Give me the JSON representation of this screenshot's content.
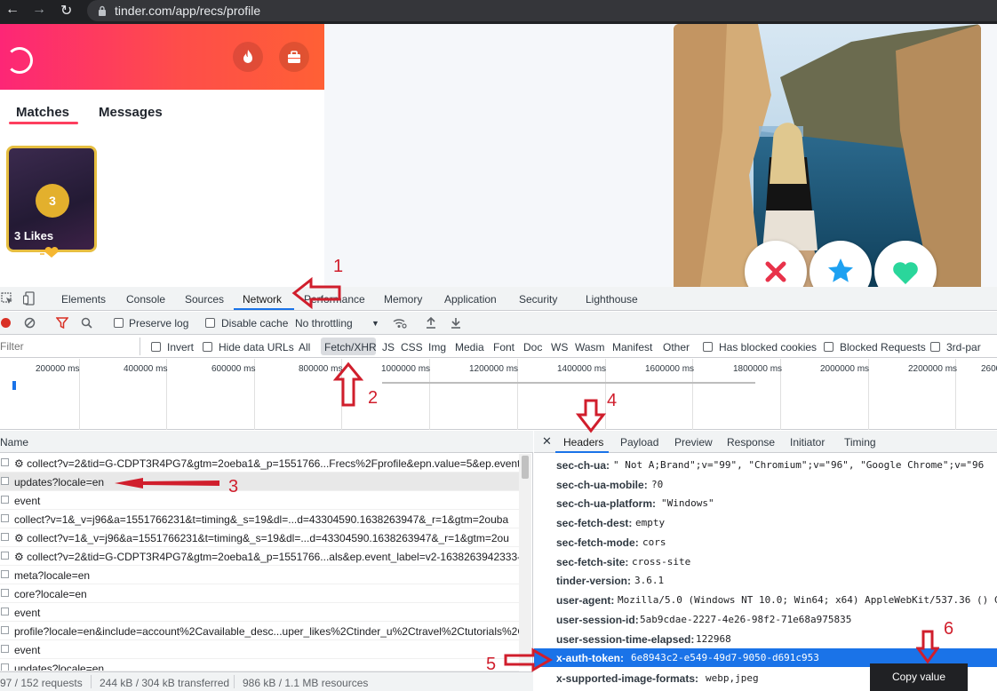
{
  "browser": {
    "url": "tinder.com/app/recs/profile"
  },
  "app": {
    "tabs": [
      "Matches",
      "Messages"
    ],
    "likes_count": "3",
    "likes_label": "3 Likes",
    "colors": {
      "brand_start": "#fd2676",
      "brand_end": "#ff6035",
      "nope": "#e8324a",
      "superlike": "#1ea1f1",
      "like": "#2ad69b"
    }
  },
  "devtools": {
    "tabs": [
      "Elements",
      "Console",
      "Sources",
      "Network",
      "Performance",
      "Memory",
      "Application",
      "Security",
      "Lighthouse"
    ],
    "toolbar": {
      "preserve_log": "Preserve log",
      "disable_cache": "Disable cache",
      "throttling": "No throttling"
    },
    "filter": {
      "placeholder": "Filter",
      "invert": "Invert",
      "hide_data_urls": "Hide data URLs",
      "types": [
        "All",
        "Fetch/XHR",
        "JS",
        "CSS",
        "Img",
        "Media",
        "Font",
        "Doc",
        "WS",
        "Wasm",
        "Manifest",
        "Other"
      ],
      "blocked_cookies": "Has blocked cookies",
      "blocked_requests": "Blocked Requests",
      "third_party": "3rd-par"
    },
    "timeline_ticks": [
      "200000 ms",
      "400000 ms",
      "600000 ms",
      "800000 ms",
      "1000000 ms",
      "1200000 ms",
      "1400000 ms",
      "1600000 ms",
      "1800000 ms",
      "2000000 ms",
      "2200000 ms",
      "2600"
    ],
    "requests": {
      "header": "Name",
      "rows": [
        "⚙ collect?v=2&tid=G-CDPT3R4PG7&gtm=2oeba1&_p=1551766...Frecs%2Fprofile&epn.value=5&ep.event_",
        "updates?locale=en",
        "event",
        "collect?v=1&_v=j96&a=1551766231&t=timing&_s=19&dl=...d=43304590.1638263947&_r=1&gtm=2ouba",
        "⚙ collect?v=1&_v=j96&a=1551766231&t=timing&_s=19&dl=...d=43304590.1638263947&_r=1&gtm=2ou",
        "⚙ collect?v=2&tid=G-CDPT3R4PG7&gtm=2oeba1&_p=1551766...als&ep.event_label=v2-1638263942333-",
        "meta?locale=en",
        "core?locale=en",
        "event",
        "profile?locale=en&include=account%2Cavailable_desc...uper_likes%2Ctinder_u%2Ctravel%2Ctutorials%2Cu",
        "event",
        "updates?locale=en"
      ],
      "status": {
        "requests": "97 / 152 requests",
        "transferred": "244 kB / 304 kB transferred",
        "resources": "986 kB / 1.1 MB resources"
      }
    },
    "details": {
      "tabs": [
        "Headers",
        "Payload",
        "Preview",
        "Response",
        "Initiator",
        "Timing"
      ],
      "headers": [
        {
          "k": "sec-ch-ua:",
          "v": "\" Not A;Brand\";v=\"99\", \"Chromium\";v=\"96\", \"Google Chrome\";v=\"96"
        },
        {
          "k": "sec-ch-ua-mobile:",
          "v": "?0"
        },
        {
          "k": "sec-ch-ua-platform:",
          "v": "\"Windows\""
        },
        {
          "k": "sec-fetch-dest:",
          "v": "empty"
        },
        {
          "k": "sec-fetch-mode:",
          "v": "cors"
        },
        {
          "k": "sec-fetch-site:",
          "v": "cross-site"
        },
        {
          "k": "tinder-version:",
          "v": "3.6.1"
        },
        {
          "k": "user-agent:",
          "v": "Mozilla/5.0 (Windows NT 10.0; Win64; x64) AppleWebKit/537.36 () C"
        },
        {
          "k": "user-session-id:",
          "v": "5ab9cdae-2227-4e26-98f2-71e68a975835"
        },
        {
          "k": "user-session-time-elapsed:",
          "v": "122968"
        },
        {
          "k": "x-auth-token:",
          "v": "6e8943c2-e549-49d7-9050-d691c953"
        },
        {
          "k": "x-supported-image-formats:",
          "v": "webp,jpeg"
        }
      ],
      "tooltip": "Copy value"
    }
  },
  "annotations": [
    "1",
    "2",
    "3",
    "4",
    "5",
    "6"
  ],
  "annotation_color": "#d01e2c"
}
